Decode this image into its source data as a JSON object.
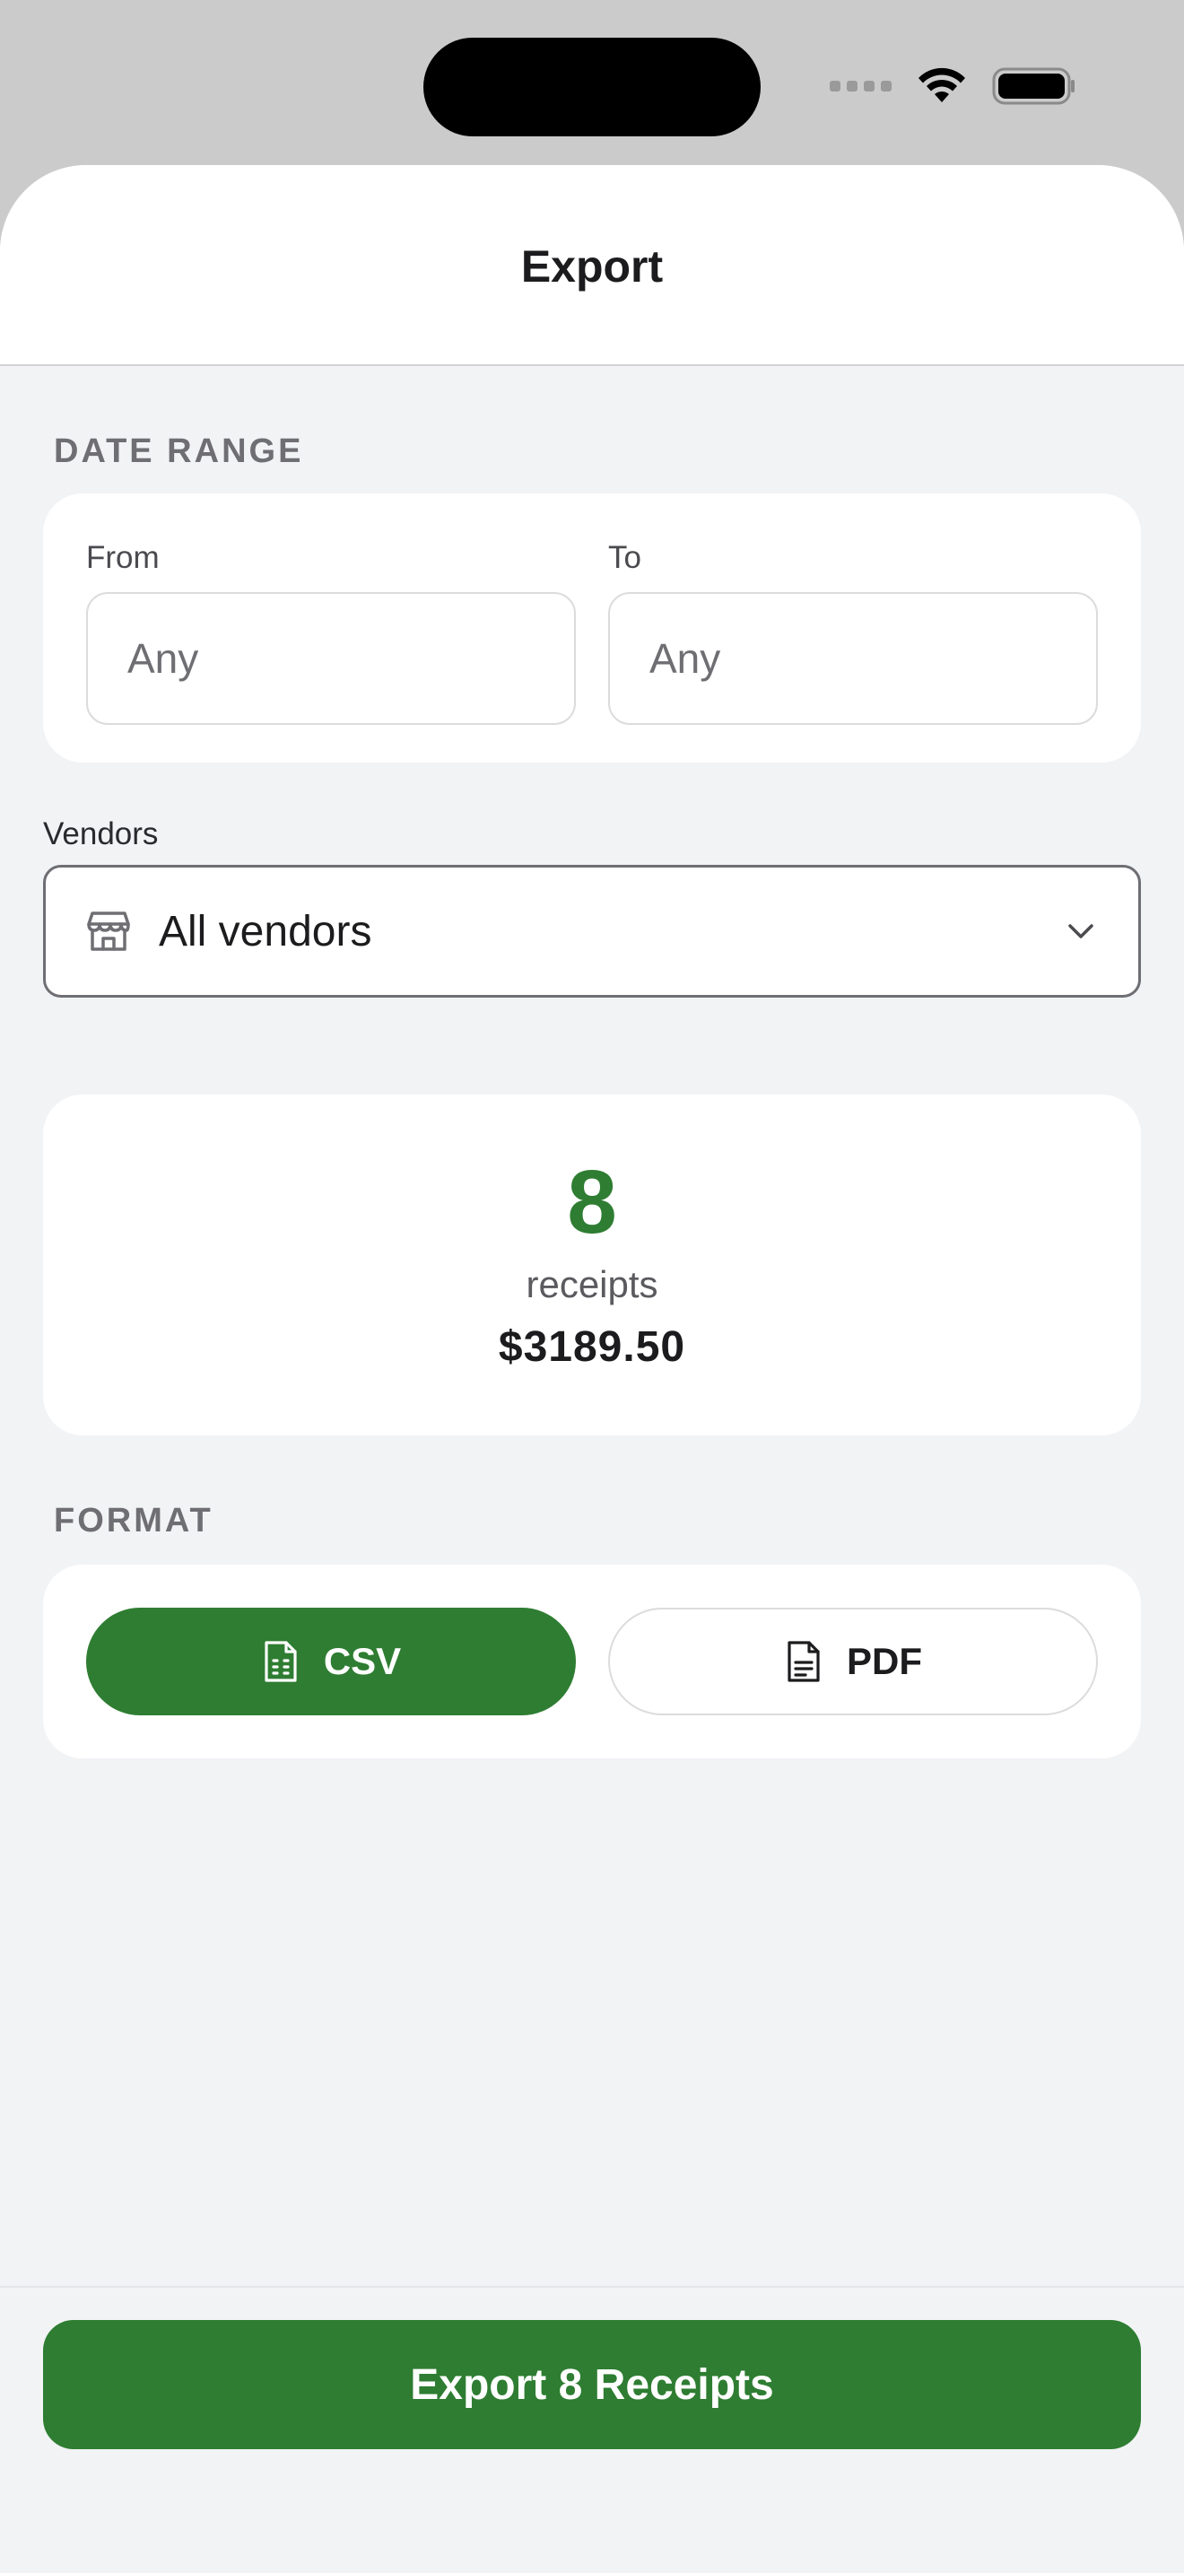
{
  "header": {
    "title": "Export"
  },
  "date_range": {
    "section_label": "DATE RANGE",
    "from": {
      "label": "From",
      "placeholder": "Any"
    },
    "to": {
      "label": "To",
      "placeholder": "Any"
    }
  },
  "vendors": {
    "label": "Vendors",
    "selected": "All vendors",
    "icon": "store-icon"
  },
  "summary": {
    "count": "8",
    "unit": "receipts",
    "total": "$3189.50"
  },
  "format": {
    "section_label": "FORMAT",
    "options": [
      {
        "label": "CSV",
        "icon": "csv-file-icon",
        "selected": true
      },
      {
        "label": "PDF",
        "icon": "pdf-file-icon",
        "selected": false
      }
    ]
  },
  "export_button": {
    "label": "Export 8 Receipts"
  },
  "colors": {
    "accent": "#2e7d32",
    "background": "#f2f3f5",
    "card": "#ffffff"
  }
}
